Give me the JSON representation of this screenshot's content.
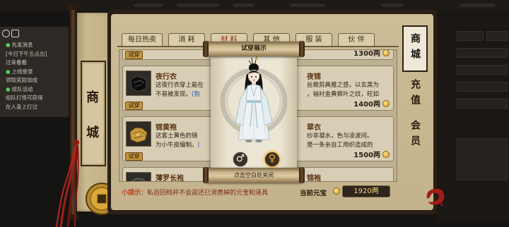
{
  "side_panel": {
    "icons": {
      "first": "face-icon",
      "second": "chat-icon"
    },
    "lines": [
      {
        "bullet": "●",
        "text": "先发消息"
      },
      {
        "bullet": "",
        "text": "[今日下午五点出]"
      },
      {
        "bullet": "",
        "text": "过来看看"
      },
      {
        "bullet": "●",
        "text": "上线登录"
      },
      {
        "bullet": "",
        "text": "领取奖励加成"
      },
      {
        "bullet": "●",
        "text": "组队活动"
      },
      {
        "bullet": "",
        "text": "组队打怪可获得"
      },
      {
        "bullet": "",
        "text": "在人身上打过"
      }
    ]
  },
  "shop": {
    "side_title": "商城",
    "tabs": [
      {
        "label": "每日热卖"
      },
      {
        "label": "消 耗"
      },
      {
        "label": "材 料",
        "highlight": true
      },
      {
        "label": "其 他"
      },
      {
        "label": "服 装"
      },
      {
        "label": "伙 伴"
      }
    ],
    "right_tabs": [
      {
        "label": "商城",
        "active": true
      },
      {
        "label": "充值"
      },
      {
        "label": "会员"
      }
    ],
    "rows": [
      {
        "left": {
          "tag": "试穿"
        },
        "right": {
          "price": "1300两"
        }
      },
      {
        "left": {
          "name": "夜行衣",
          "icon": "black-garment-icon",
          "desc1": "这夜行衣穿上能在",
          "desc2": "不易被发现。",
          "link": "(购",
          "tag": "试穿"
        },
        "right": {
          "name": "夜锦",
          "desc1": "丝裁剪典雅之感，以玄黑为",
          "desc2": "，袖衬金黄枫叶之纹，旺如",
          "price": "1400两"
        }
      },
      {
        "left": {
          "name": "锦黄袍",
          "icon": "yellow-garment-icon",
          "desc1": "这套土黄色的锦",
          "desc2": "为小牛皮编制。",
          "link": "(",
          "tag": "试穿"
        },
        "right": {
          "name": "翠衣",
          "desc1": "纱非凝水，色与凌波间。",
          "desc2": "是一条亲自工用织造成的",
          "price": "1500两"
        }
      },
      {
        "left": {
          "name": "薄罗长袍",
          "icon": "dark-garment-icon"
        },
        "right": {
          "name": "锦袍"
        }
      }
    ],
    "tip_label": "小提示：",
    "tip_text": "私自回档并不会返还已消费掉的元宝和道具",
    "balance_label": "当前元宝",
    "balance": "1920两"
  },
  "modal": {
    "title": "试穿展示",
    "close_hint": "点击空白处关闭",
    "gender_options": [
      {
        "name": "male",
        "symbol": "♂"
      },
      {
        "name": "female",
        "symbol": "♀"
      }
    ],
    "selected_gender": "female"
  },
  "colors": {
    "parchment": "#cdbd97",
    "frame_dark": "#2a1f15",
    "selected_gender": "#f2a51f",
    "tip_label": "#c0401c",
    "balance_text": "#f3d27a"
  }
}
